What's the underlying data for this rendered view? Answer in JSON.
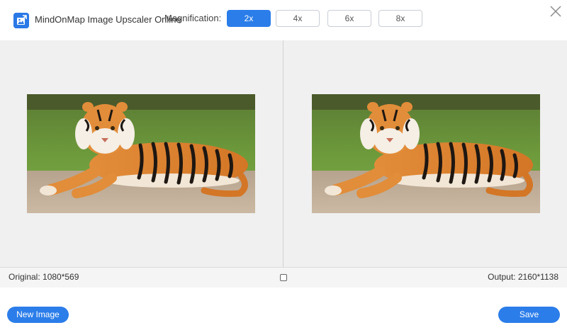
{
  "header": {
    "app_title": "MindOnMap Image Upscaler Online",
    "magnification_label": "Magnification:",
    "magnification_options": [
      "2x",
      "4x",
      "6x",
      "8x"
    ],
    "selected_magnification": "2x",
    "logo_icon": "image-upscale-logo-icon",
    "close_icon": "close-icon"
  },
  "preview": {
    "original_image": "tiger-lying-on-sand-photo",
    "output_image": "tiger-lying-on-sand-photo"
  },
  "info": {
    "original": "Original: 1080*569",
    "output": "Output: 2160*1138",
    "compare_icon": "compare-square-icon"
  },
  "footer": {
    "new_image_label": "New Image",
    "save_label": "Save"
  },
  "colors": {
    "accent": "#2b7de9",
    "preview_bg": "#f0f0f0"
  }
}
